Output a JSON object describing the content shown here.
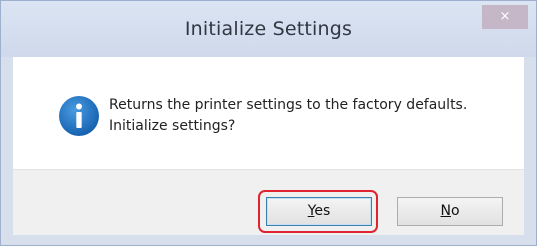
{
  "window": {
    "title": "Initialize Settings",
    "close_glyph": "×"
  },
  "message": {
    "icon": "info-icon",
    "line1": "Returns the printer settings to the factory defaults.",
    "line2": "Initialize settings?"
  },
  "buttons": {
    "yes": {
      "accel": "Y",
      "rest": "es"
    },
    "no": {
      "accel": "N",
      "rest": "o"
    }
  },
  "colors": {
    "info_icon": "#1e73c4",
    "highlight": "#e0242f",
    "title_bar": "#d7dfed"
  }
}
